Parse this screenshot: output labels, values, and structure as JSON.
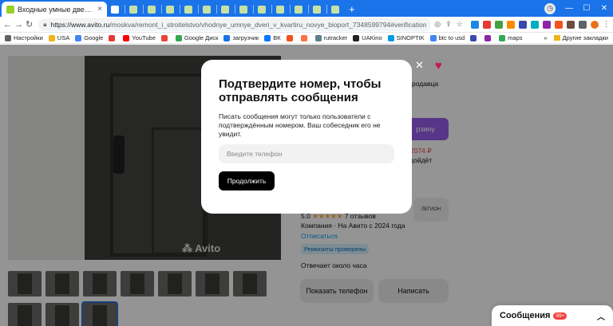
{
  "browser": {
    "active_tab_title": "Входные умные двери в квартиру",
    "url_host": "https://www.avito.ru",
    "url_path": "/moskva/remont_i_stroitelstvo/vhodnye_umnye_dveri_v_kvartiru_novye_bioport_7348599794#verificationView/sta...",
    "tab_close": "×",
    "new_tab": "+",
    "win_min": "—",
    "win_max": "☐",
    "win_close": "✕"
  },
  "bookmarks": {
    "items": [
      {
        "label": "Настройки",
        "color": "#5f6368"
      },
      {
        "label": "USA",
        "color": "#f2b21b"
      },
      {
        "label": "Google",
        "color": "#4285f4"
      },
      {
        "label": "",
        "color": "#e53935"
      },
      {
        "label": "YouTube",
        "color": "#ff0000"
      },
      {
        "label": "",
        "color": "#ea4335"
      },
      {
        "label": "Google Диск",
        "color": "#34a853"
      },
      {
        "label": "загрузчик",
        "color": "#1a73e8"
      },
      {
        "label": "ВК",
        "color": "#0077ff"
      },
      {
        "label": "",
        "color": "#f4511e"
      },
      {
        "label": "",
        "color": "#ff7043"
      },
      {
        "label": "rutracker",
        "color": "#607d8b"
      },
      {
        "label": "UAKino",
        "color": "#212121"
      },
      {
        "label": "SINOPTIK",
        "color": "#039be5"
      },
      {
        "label": "btc to usd",
        "color": "#4285f4"
      },
      {
        "label": "",
        "color": "#3949ab"
      },
      {
        "label": "",
        "color": "#8e24aa"
      },
      {
        "label": "maps",
        "color": "#34a853"
      }
    ],
    "more": "»",
    "other": "Другие закладки"
  },
  "page": {
    "avito_watermark": "Avito",
    "seller_text_partial": "родавца",
    "purple_button_partial": "рзину",
    "price_partial": "2074 ₽",
    "fits_partial": "подойдёт",
    "rating": "5.0",
    "stars": "★★★★★",
    "reviews": "7 отзывов",
    "seller_logo_text": "ЛЕГИОН",
    "company": "Компания · На Авито с 2024 года",
    "unsubscribe": "Отписаться",
    "verified": "Реквизиты проверены",
    "reply_time": "Отвечает около часа",
    "show_phone": "Показать телефон",
    "write": "Написать",
    "messages_label": "Сообщения",
    "messages_count": "99+"
  },
  "modal": {
    "title": "Подтвердите номер, чтобы отправлять сообщения",
    "text": "Писать сообщения могут только пользователи с подтверждённым номером. Ваш собеседник его не увидит.",
    "phone_placeholder": "Введите телефон",
    "phone_value": "",
    "continue": "Продолжить"
  },
  "colors": {
    "chrome_blue": "#1a73e8",
    "avito_purple": "#965eeb",
    "price_red": "#f1433d",
    "link_blue": "#0099f7"
  }
}
